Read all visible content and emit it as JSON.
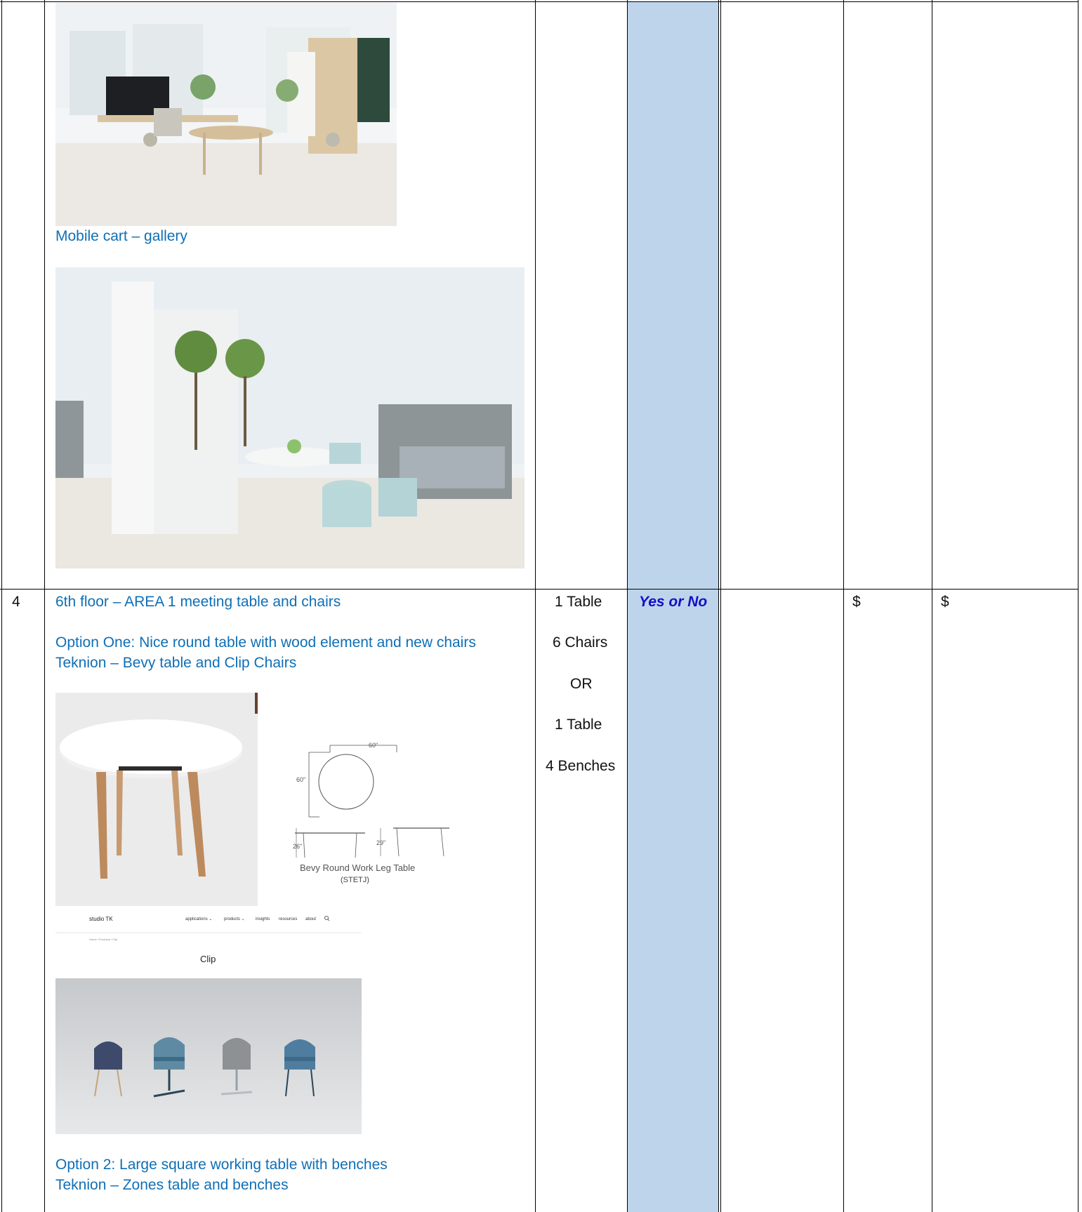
{
  "row_prev": {
    "caption1": "Mobile cart – gallery"
  },
  "row4": {
    "number": "4",
    "title": "6th floor – AREA 1 meeting table and chairs",
    "option1_line1": "Option One: Nice round table with wood element and new chairs",
    "option1_line2": "Teknion – Bevy table and Clip Chairs",
    "option2_line1": "Option 2: Large square working table with benches",
    "option2_line2": "Teknion – Zones table and benches",
    "quantities": [
      "1 Table",
      "6 Chairs",
      "OR",
      "1 Table",
      "4 Benches"
    ],
    "yes_no": "Yes or No",
    "price1": "$",
    "price2": "$"
  },
  "drawing": {
    "dim_top": "60\"",
    "dim_side": "60\"",
    "dim_h1": "26\"",
    "dim_h2": "29\"",
    "caption": "Bevy Round Work Leg Table",
    "code": "(STETJ)"
  },
  "webshot": {
    "logo": "studio TK",
    "nav": [
      "applications ⌄",
      "products ⌄",
      "insights",
      "resources",
      "about"
    ],
    "breadcrumb": "Home / Products / Clip",
    "product_title": "Clip"
  },
  "colors": {
    "link_blue": "#0f6fb5",
    "shade_blue": "#bed4ea",
    "yes_no_blue": "#1010c8"
  }
}
